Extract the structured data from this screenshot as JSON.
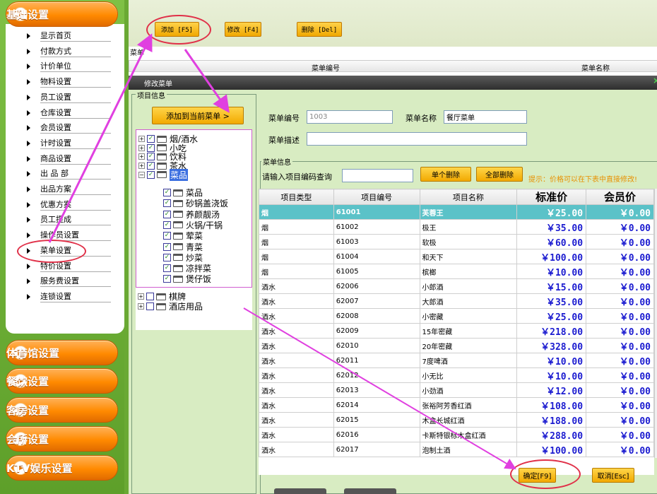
{
  "sidebar": {
    "main_section": "基础设置",
    "items": [
      "显示首页",
      "付款方式",
      "计价单位",
      "物料设置",
      "员工设置",
      "仓库设置",
      "会员设置",
      "计时设置",
      "商品设置",
      "出 品 部",
      "出品方案",
      "优惠方案",
      "员工提成",
      "操作员设置",
      "菜单设置",
      "特价设置",
      "服务费设置",
      "连锁设置"
    ],
    "sections": [
      "体育馆设置",
      "餐饮设置",
      "客房设置",
      "会所设置",
      "KTV娱乐设置"
    ]
  },
  "toolbar": {
    "add": "添加 [F5]",
    "edit": "修改 [F4]",
    "delete": "删除 [Del]"
  },
  "menu_list": {
    "caption": "菜单",
    "col_code": "菜单编号",
    "col_name": "菜单名称"
  },
  "dialog": {
    "title": "修改菜单",
    "close": "×",
    "item_info": "项目信息",
    "add_to_menu": "添加到当前菜单 >",
    "menu_code_label": "菜单编号",
    "menu_code_value": "1003",
    "menu_name_label": "菜单名称",
    "menu_name_value": "餐厅菜单",
    "menu_desc_label": "菜单描述",
    "menu_info": "菜单信息",
    "search_label": "请输入项目编码查询",
    "delete_one": "单个删除",
    "delete_all": "全部删除",
    "hint": "提示：价格可以在下表中直接修改!",
    "confirm": "确定[F9]",
    "cancel": "取消[Esc]"
  },
  "tree": {
    "top": [
      {
        "label": "烟/酒水",
        "checked": true
      },
      {
        "label": "小吃",
        "checked": true
      },
      {
        "label": "饮料",
        "checked": true
      },
      {
        "label": "茶水",
        "checked": true
      },
      {
        "label": "菜品",
        "checked": true
      }
    ],
    "children": [
      "菜品",
      "砂锅盖浇饭",
      "养颜靓汤",
      "火锅/干锅",
      "荤菜",
      "青菜",
      "炒菜",
      "凉拌菜",
      "煲仔饭"
    ],
    "bottom": [
      {
        "label": "棋牌",
        "checked": false
      },
      {
        "label": "酒店用品",
        "checked": false
      }
    ]
  },
  "table": {
    "headers": [
      "项目类型",
      "项目编号",
      "项目名称",
      "标准价",
      "会员价"
    ],
    "rows": [
      [
        "烟",
        "61001",
        "芙蓉王",
        "￥25.00",
        "￥0.00"
      ],
      [
        "烟",
        "61002",
        "极王",
        "￥35.00",
        "￥0.00"
      ],
      [
        "烟",
        "61003",
        "软极",
        "￥60.00",
        "￥0.00"
      ],
      [
        "烟",
        "61004",
        "和天下",
        "￥100.00",
        "￥0.00"
      ],
      [
        "烟",
        "61005",
        "槟榔",
        "￥10.00",
        "￥0.00"
      ],
      [
        "酒水",
        "62006",
        "小郎酒",
        "￥15.00",
        "￥0.00"
      ],
      [
        "酒水",
        "62007",
        "大郎酒",
        "￥35.00",
        "￥0.00"
      ],
      [
        "酒水",
        "62008",
        "小密藏",
        "￥25.00",
        "￥0.00"
      ],
      [
        "酒水",
        "62009",
        "15年密藏",
        "￥218.00",
        "￥0.00"
      ],
      [
        "酒水",
        "62010",
        "20年密藏",
        "￥328.00",
        "￥0.00"
      ],
      [
        "酒水",
        "62011",
        "7度啤酒",
        "￥10.00",
        "￥0.00"
      ],
      [
        "酒水",
        "62012",
        "小无比",
        "￥10.00",
        "￥0.00"
      ],
      [
        "酒水",
        "62013",
        "小劲酒",
        "￥12.00",
        "￥0.00"
      ],
      [
        "酒水",
        "62014",
        "张裕阿芳香红酒",
        "￥108.00",
        "￥0.00"
      ],
      [
        "酒水",
        "62015",
        "木盒长城红酒",
        "￥188.00",
        "￥0.00"
      ],
      [
        "酒水",
        "62016",
        "卡斯特银标木盒红酒",
        "￥288.00",
        "￥0.00"
      ],
      [
        "酒水",
        "62017",
        "泡制土酒",
        "￥100.00",
        "￥0.00"
      ]
    ]
  }
}
